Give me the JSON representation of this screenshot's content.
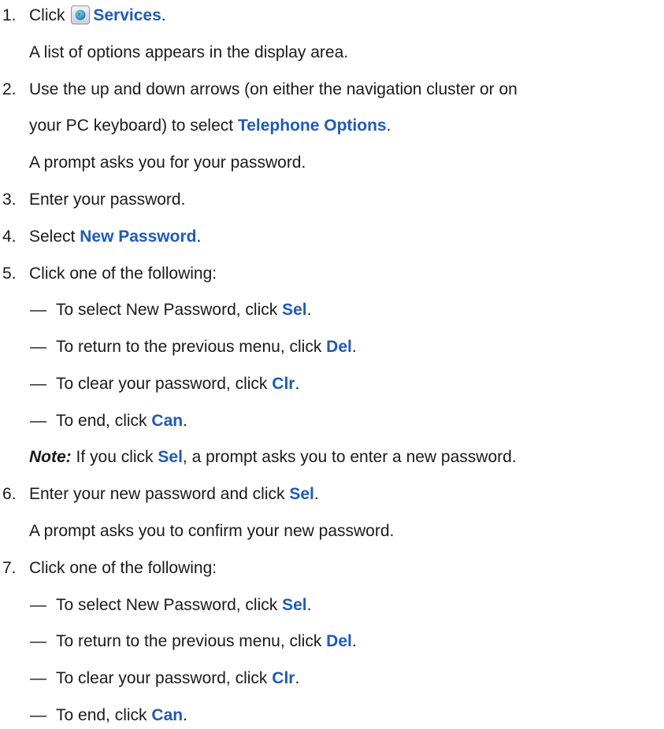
{
  "step1": {
    "number": "1.",
    "prefix": "Click",
    "keyword": "Services",
    "suffix": ".",
    "icon": "globe-icon"
  },
  "step1_result": "A  list of options appears in the display area.",
  "step2": {
    "number": "2.",
    "line1": "Use the up and down arrows (on either the navigation cluster or on",
    "line2_prefix": "your PC keyboard) to select",
    "keyword": "Telephone Options",
    "suffix": "."
  },
  "step2_result": "A prompt asks you for your password.",
  "step3": {
    "number": "3.",
    "text": "Enter your password."
  },
  "step4": {
    "number": "4.",
    "prefix": "Select",
    "keyword": "New Password",
    "suffix": "."
  },
  "step5": {
    "number": "5.",
    "text": "Click one of the following:",
    "options": [
      {
        "dash": "—",
        "prefix": "To select New Password, click",
        "keyword": "Sel",
        "suffix": "."
      },
      {
        "dash": "—",
        "prefix": "To return to the previous menu, click",
        "keyword": "Del",
        "suffix": "."
      },
      {
        "dash": "—",
        "prefix": "To clear your password, click",
        "keyword": "Clr",
        "suffix": "."
      },
      {
        "dash": "—",
        "prefix": "To end, click",
        "keyword": "Can",
        "suffix": "."
      }
    ]
  },
  "note": {
    "label": "Note:",
    "prefix": "If you click",
    "keyword": "Sel",
    "suffix": ", a prompt asks you to enter a new password."
  },
  "step6": {
    "number": "6.",
    "prefix": "Enter your new password and click",
    "keyword": "Sel",
    "suffix": "."
  },
  "step6_result": "A prompt asks you to confirm your new password.",
  "step7": {
    "number": "7.",
    "text": "Click one of the following:",
    "options": [
      {
        "dash": "—",
        "prefix": "To select New Password, click",
        "keyword": "Sel",
        "suffix": "."
      },
      {
        "dash": "—",
        "prefix": "To return to the previous menu, click",
        "keyword": "Del",
        "suffix": "."
      },
      {
        "dash": "—",
        "prefix": "To clear your password, click",
        "keyword": "Clr",
        "suffix": "."
      },
      {
        "dash": "—",
        "prefix": "To end, click",
        "keyword": "Can",
        "suffix": "."
      }
    ]
  },
  "colors": {
    "keyword": "#1f5bb5",
    "text": "#1a1a1a"
  }
}
